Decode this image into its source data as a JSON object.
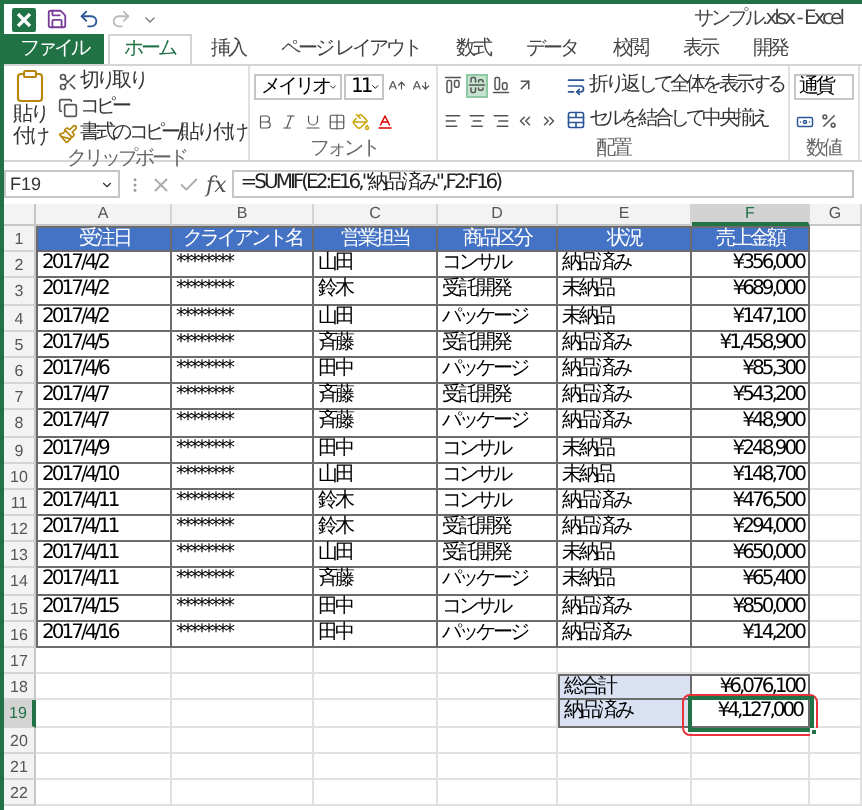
{
  "window": {
    "title": "サンプル.xlsx - Excel"
  },
  "tabs": [
    {
      "label": "ファイル",
      "kind": "file",
      "selected": false
    },
    {
      "label": "ホーム",
      "kind": "tab",
      "selected": true
    },
    {
      "label": "挿入",
      "kind": "tab",
      "selected": false
    },
    {
      "label": "ページ レイアウト",
      "kind": "tab",
      "selected": false
    },
    {
      "label": "数式",
      "kind": "tab",
      "selected": false
    },
    {
      "label": "データ",
      "kind": "tab",
      "selected": false
    },
    {
      "label": "校閲",
      "kind": "tab",
      "selected": false
    },
    {
      "label": "表示",
      "kind": "tab",
      "selected": false
    },
    {
      "label": "開発",
      "kind": "tab",
      "selected": false
    }
  ],
  "ribbon": {
    "clipboard": {
      "paste": "貼り付け",
      "cut": "切り取り",
      "copy": "コピー",
      "format_painter": "書式のコピー/貼り付け",
      "group_label": "クリップボード"
    },
    "font": {
      "font_name": "メイリオ",
      "font_size": "11",
      "group_label": "フォント"
    },
    "alignment": {
      "vertical_align": [
        {
          "selected": false
        },
        {
          "selected": true
        },
        {
          "selected": false
        }
      ],
      "wrap_text": "折り返して全体を表示する",
      "merge_center": "セルを結合して中央揃え",
      "group_label": "配置"
    },
    "number": {
      "format": "通貨",
      "group_label": "数値"
    }
  },
  "formula_bar": {
    "name_box": "F19",
    "function_label": "fx",
    "formula": "=SUMIF(E2:E16,\"納品済み\",F2:F16)"
  },
  "sheet": {
    "columns": [
      {
        "label": "A",
        "selected": false
      },
      {
        "label": "B",
        "selected": false
      },
      {
        "label": "C",
        "selected": false
      },
      {
        "label": "D",
        "selected": false
      },
      {
        "label": "E",
        "selected": false
      },
      {
        "label": "F",
        "selected": true
      },
      {
        "label": "G",
        "selected": false
      }
    ],
    "rows": [
      {
        "label": "1",
        "selected": false
      },
      {
        "label": "2",
        "selected": false
      },
      {
        "label": "3",
        "selected": false
      },
      {
        "label": "4",
        "selected": false
      },
      {
        "label": "5",
        "selected": false
      },
      {
        "label": "6",
        "selected": false
      },
      {
        "label": "7",
        "selected": false
      },
      {
        "label": "8",
        "selected": false
      },
      {
        "label": "9",
        "selected": false
      },
      {
        "label": "10",
        "selected": false
      },
      {
        "label": "11",
        "selected": false
      },
      {
        "label": "12",
        "selected": false
      },
      {
        "label": "13",
        "selected": false
      },
      {
        "label": "14",
        "selected": false
      },
      {
        "label": "15",
        "selected": false
      },
      {
        "label": "16",
        "selected": false
      },
      {
        "label": "17",
        "selected": false
      },
      {
        "label": "18",
        "selected": false
      },
      {
        "label": "19",
        "selected": true
      },
      {
        "label": "20",
        "selected": false
      },
      {
        "label": "21",
        "selected": false
      },
      {
        "label": "22",
        "selected": false
      }
    ],
    "table": {
      "header": [
        "受注日",
        "クライアント名",
        "営業担当",
        "商品区分",
        "状況",
        "売上金額"
      ],
      "rows": [
        [
          "2017/4/2",
          "********",
          "山田",
          "コンサル",
          "納品済み",
          "¥356,000"
        ],
        [
          "2017/4/2",
          "********",
          "鈴木",
          "受託開発",
          "未納品",
          "¥689,000"
        ],
        [
          "2017/4/2",
          "********",
          "山田",
          "パッケージ",
          "未納品",
          "¥147,100"
        ],
        [
          "2017/4/5",
          "********",
          "斉藤",
          "受託開発",
          "納品済み",
          "¥1,458,900"
        ],
        [
          "2017/4/6",
          "********",
          "田中",
          "パッケージ",
          "納品済み",
          "¥85,300"
        ],
        [
          "2017/4/7",
          "********",
          "斉藤",
          "受託開発",
          "納品済み",
          "¥543,200"
        ],
        [
          "2017/4/7",
          "********",
          "斉藤",
          "パッケージ",
          "納品済み",
          "¥48,900"
        ],
        [
          "2017/4/9",
          "********",
          "田中",
          "コンサル",
          "未納品",
          "¥248,900"
        ],
        [
          "2017/4/10",
          "********",
          "山田",
          "コンサル",
          "未納品",
          "¥148,700"
        ],
        [
          "2017/4/11",
          "********",
          "鈴木",
          "コンサル",
          "納品済み",
          "¥476,500"
        ],
        [
          "2017/4/11",
          "********",
          "鈴木",
          "受託開発",
          "納品済み",
          "¥294,000"
        ],
        [
          "2017/4/11",
          "********",
          "山田",
          "受託開発",
          "未納品",
          "¥650,000"
        ],
        [
          "2017/4/11",
          "********",
          "斉藤",
          "パッケージ",
          "未納品",
          "¥65,400"
        ],
        [
          "2017/4/15",
          "********",
          "田中",
          "コンサル",
          "納品済み",
          "¥850,000"
        ],
        [
          "2017/4/16",
          "********",
          "田中",
          "パッケージ",
          "納品済み",
          "¥14,200"
        ]
      ]
    },
    "summary": [
      {
        "label": "総合計",
        "value": "¥6,076,100",
        "selected": false,
        "circled": false
      },
      {
        "label": "納品済み",
        "value": "¥4,127,000",
        "selected": true,
        "circled": true
      }
    ]
  }
}
